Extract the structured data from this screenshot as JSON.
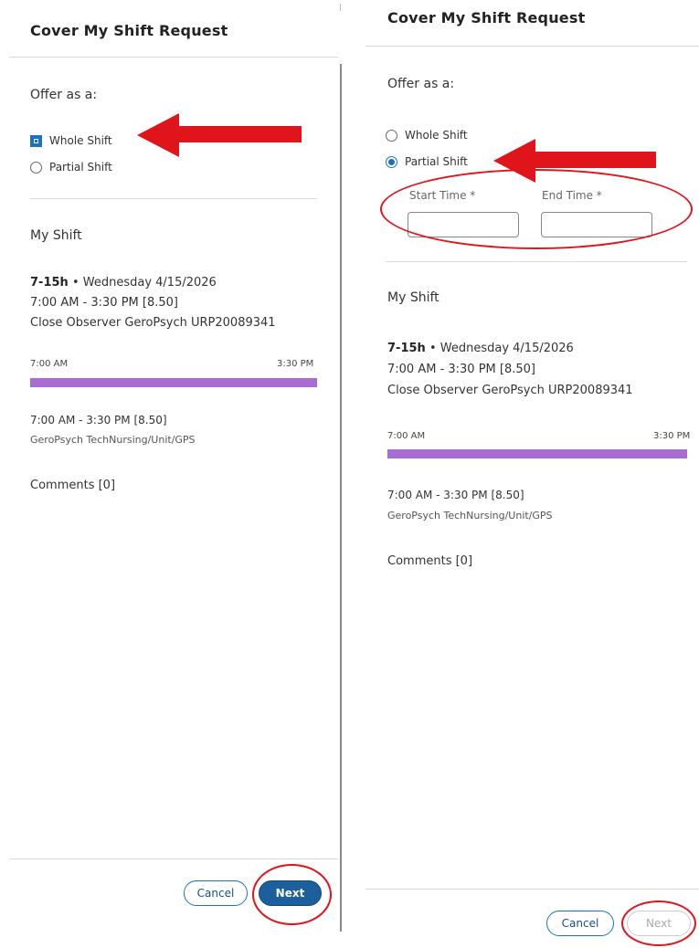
{
  "left": {
    "title": "Cover My Shift Request",
    "offer_label": "Offer as a:",
    "options": [
      {
        "label": "Whole Shift",
        "state": "selected-checkbox"
      },
      {
        "label": "Partial Shift",
        "state": "unselected"
      }
    ],
    "my_shift_heading": "My Shift",
    "shift_code": "7-15h",
    "shift_bullet": "•",
    "shift_date": "Wednesday 4/15/2026",
    "shift_time": "7:00 AM - 3:30 PM [8.50]",
    "shift_position": "Close Observer GeroPsych URP20089341",
    "timeline_start": "7:00 AM",
    "timeline_end": "3:30 PM",
    "detail_time": "7:00 AM - 3:30 PM [8.50]",
    "detail_unit": "GeroPsych TechNursing/Unit/GPS",
    "comments": "Comments [0]",
    "cancel_label": "Cancel",
    "next_label": "Next"
  },
  "right": {
    "title": "Cover My Shift Request",
    "offer_label": "Offer as a:",
    "options": [
      {
        "label": "Whole Shift",
        "state": "unselected"
      },
      {
        "label": "Partial Shift",
        "state": "selected"
      }
    ],
    "start_time_label": "Start Time *",
    "end_time_label": "End Time *",
    "start_time_value": "",
    "end_time_value": "",
    "my_shift_heading": "My Shift",
    "shift_code": "7-15h",
    "shift_bullet": "•",
    "shift_date": "Wednesday 4/15/2026",
    "shift_time": "7:00 AM - 3:30 PM [8.50]",
    "shift_position": "Close Observer GeroPsych URP20089341",
    "timeline_start": "7:00 AM",
    "timeline_end": "3:30 PM",
    "detail_time": "7:00 AM - 3:30 PM [8.50]",
    "detail_unit": "GeroPsych TechNursing/Unit/GPS",
    "comments": "Comments [0]",
    "cancel_label": "Cancel",
    "next_label": "Next",
    "next_disabled": true
  },
  "colors": {
    "primary": "#1b5f9c",
    "accent_radio": "#1b72c0",
    "timeline_bar": "#a96dd2",
    "annotation_red": "#e0141b"
  },
  "annotations": [
    {
      "type": "arrow",
      "points_to": "left whole shift option"
    },
    {
      "type": "circle",
      "highlights": "left next button"
    },
    {
      "type": "arrow",
      "points_to": "right partial shift option"
    },
    {
      "type": "circle",
      "highlights": "right start/end time fields"
    },
    {
      "type": "circle",
      "highlights": "right next button"
    }
  ]
}
